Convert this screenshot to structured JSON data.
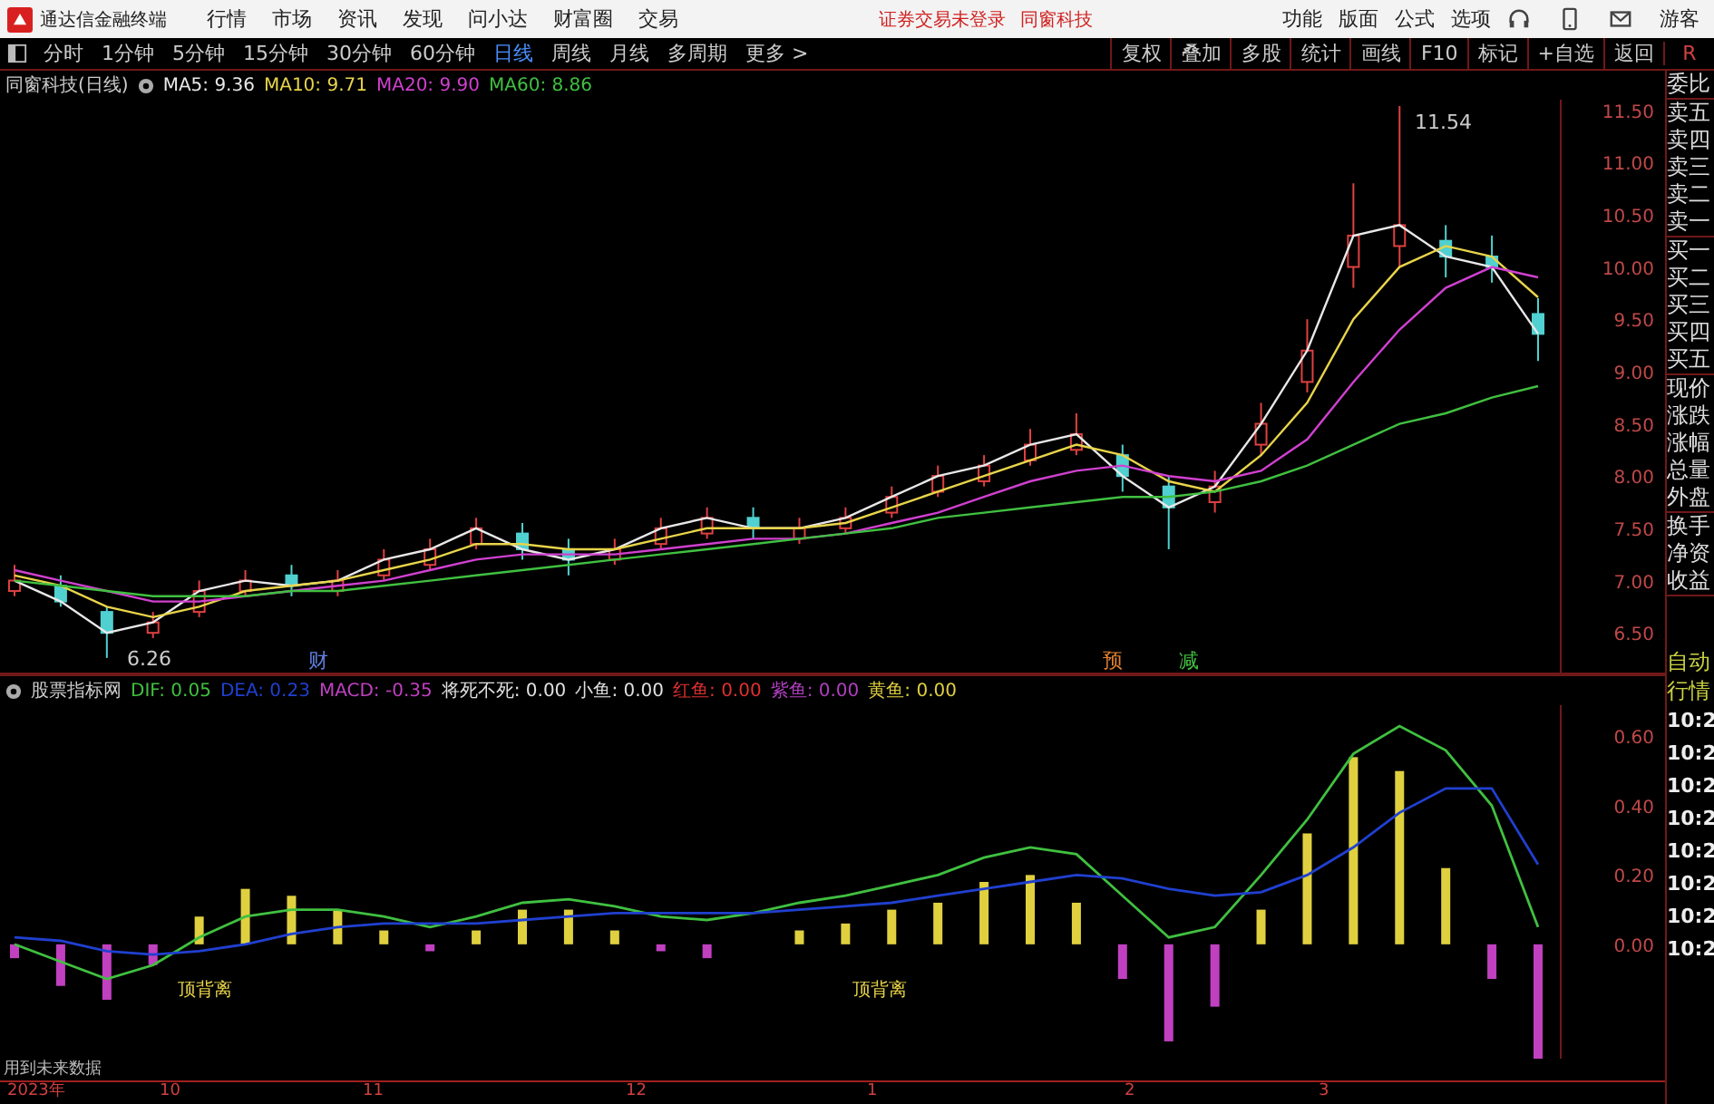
{
  "titlebar": {
    "app_name": "通达信金融终端",
    "menu": [
      "行情",
      "市场",
      "资讯",
      "发现",
      "问小达",
      "财富圈",
      "交易"
    ],
    "notices": [
      "证券交易未登录",
      "同窗科技"
    ],
    "tools": [
      "功能",
      "版面",
      "公式",
      "选项"
    ],
    "user": "游客"
  },
  "period_tabs": [
    {
      "label": "分时",
      "selected": false
    },
    {
      "label": "1分钟",
      "selected": false
    },
    {
      "label": "5分钟",
      "selected": false
    },
    {
      "label": "15分钟",
      "selected": false
    },
    {
      "label": "30分钟",
      "selected": false
    },
    {
      "label": "60分钟",
      "selected": false
    },
    {
      "label": "日线",
      "selected": true
    },
    {
      "label": "周线",
      "selected": false
    },
    {
      "label": "月线",
      "selected": false
    },
    {
      "label": "多周期",
      "selected": false
    },
    {
      "label": "更多 >",
      "selected": false
    }
  ],
  "chart_buttons": [
    "复权",
    "叠加",
    "多股",
    "统计",
    "画线",
    "F10",
    "标记",
    "+自选",
    "返回"
  ],
  "price_pane": {
    "title": "同窗科技(日线)",
    "legend": [
      {
        "label": "MA5: 9.36",
        "color": "#e8e8e8"
      },
      {
        "label": "MA10: 9.71",
        "color": "#e8d44a"
      },
      {
        "label": "MA20: 9.90",
        "color": "#d040d0"
      },
      {
        "label": "MA60: 8.86",
        "color": "#40c040"
      }
    ],
    "annotations": [
      "11.54",
      "6.26",
      "财",
      "预",
      "减"
    ],
    "candles": {
      "chart_data": {
        "type": "candlestick",
        "ylim": [
          6.12,
          11.6
        ],
        "yticks": [
          {
            "value": 6.5,
            "label": "6.50"
          },
          {
            "value": 7,
            "label": "7.00"
          },
          {
            "value": 7.5,
            "label": "7.50"
          },
          {
            "value": 8,
            "label": "8.00"
          },
          {
            "value": 8.5,
            "label": "8.50"
          },
          {
            "value": 9,
            "label": "9.00"
          },
          {
            "value": 9.5,
            "label": "9.50"
          },
          {
            "value": 10,
            "label": "10.00"
          },
          {
            "value": 10.5,
            "label": "10.50"
          },
          {
            "value": 11,
            "label": "11.00"
          },
          {
            "value": 11.5,
            "label": "11.50"
          }
        ],
        "ohlc": [
          [
            6.9,
            7.15,
            6.85,
            7.0
          ],
          [
            6.95,
            7.05,
            6.75,
            6.8
          ],
          [
            6.7,
            6.75,
            6.26,
            6.5
          ],
          [
            6.5,
            6.7,
            6.45,
            6.6
          ],
          [
            6.7,
            7.0,
            6.65,
            6.9
          ],
          [
            6.9,
            7.1,
            6.85,
            7.0
          ],
          [
            7.05,
            7.15,
            6.85,
            6.95
          ],
          [
            6.9,
            7.1,
            6.85,
            7.0
          ],
          [
            7.05,
            7.3,
            7.0,
            7.2
          ],
          [
            7.15,
            7.4,
            7.1,
            7.3
          ],
          [
            7.35,
            7.6,
            7.3,
            7.5
          ],
          [
            7.45,
            7.55,
            7.2,
            7.3
          ],
          [
            7.3,
            7.4,
            7.05,
            7.2
          ],
          [
            7.2,
            7.4,
            7.15,
            7.3
          ],
          [
            7.35,
            7.6,
            7.3,
            7.5
          ],
          [
            7.45,
            7.7,
            7.4,
            7.6
          ],
          [
            7.6,
            7.7,
            7.4,
            7.5
          ],
          [
            7.4,
            7.6,
            7.35,
            7.5
          ],
          [
            7.5,
            7.7,
            7.45,
            7.6
          ],
          [
            7.65,
            7.9,
            7.6,
            7.8
          ],
          [
            7.85,
            8.1,
            7.8,
            8.0
          ],
          [
            7.95,
            8.2,
            7.9,
            8.1
          ],
          [
            8.15,
            8.45,
            8.1,
            8.3
          ],
          [
            8.25,
            8.6,
            8.2,
            8.4
          ],
          [
            8.2,
            8.3,
            7.85,
            8.0
          ],
          [
            7.9,
            8.0,
            7.3,
            7.7
          ],
          [
            7.75,
            8.05,
            7.65,
            7.9
          ],
          [
            8.3,
            8.7,
            8.2,
            8.5
          ],
          [
            8.9,
            9.5,
            8.8,
            9.2
          ],
          [
            10.0,
            10.8,
            9.8,
            10.3
          ],
          [
            10.2,
            11.54,
            10.0,
            10.4
          ],
          [
            10.25,
            10.4,
            9.9,
            10.1
          ],
          [
            10.1,
            10.3,
            9.85,
            10.0
          ],
          [
            9.55,
            9.7,
            9.1,
            9.36
          ]
        ]
      }
    },
    "moving_averages": {
      "chart_data": {
        "type": "line",
        "ylim": [
          6.12,
          11.6
        ],
        "series": [
          {
            "color": "#e8e8e8",
            "values": [
              7.0,
              6.8,
              6.5,
              6.6,
              6.9,
              7.0,
              6.95,
              7.0,
              7.2,
              7.3,
              7.5,
              7.3,
              7.2,
              7.3,
              7.5,
              7.6,
              7.5,
              7.5,
              7.6,
              7.8,
              8.0,
              8.1,
              8.3,
              8.4,
              8.0,
              7.7,
              7.9,
              8.5,
              9.2,
              10.3,
              10.4,
              10.1,
              10.0,
              9.36
            ]
          },
          {
            "color": "#e8d44a",
            "values": [
              7.05,
              6.95,
              6.75,
              6.65,
              6.75,
              6.9,
              6.95,
              7.0,
              7.1,
              7.2,
              7.35,
              7.35,
              7.3,
              7.3,
              7.4,
              7.5,
              7.5,
              7.5,
              7.55,
              7.7,
              7.85,
              8.0,
              8.15,
              8.3,
              8.2,
              7.95,
              7.85,
              8.2,
              8.7,
              9.5,
              10.0,
              10.2,
              10.1,
              9.71
            ]
          },
          {
            "color": "#d040d0",
            "values": [
              7.1,
              7.0,
              6.9,
              6.8,
              6.8,
              6.85,
              6.9,
              6.95,
              7.0,
              7.1,
              7.2,
              7.25,
              7.25,
              7.25,
              7.3,
              7.35,
              7.4,
              7.4,
              7.45,
              7.55,
              7.65,
              7.8,
              7.95,
              8.05,
              8.1,
              8.0,
              7.95,
              8.05,
              8.35,
              8.9,
              9.4,
              9.8,
              10.0,
              9.9
            ]
          },
          {
            "color": "#40c040",
            "values": [
              7.0,
              6.95,
              6.9,
              6.85,
              6.85,
              6.85,
              6.9,
              6.9,
              6.95,
              7.0,
              7.05,
              7.1,
              7.15,
              7.2,
              7.25,
              7.3,
              7.35,
              7.4,
              7.45,
              7.5,
              7.6,
              7.65,
              7.7,
              7.75,
              7.8,
              7.8,
              7.85,
              7.95,
              8.1,
              8.3,
              8.5,
              8.6,
              8.75,
              8.86
            ]
          }
        ]
      }
    }
  },
  "macd_pane": {
    "title": "股票指标网",
    "legend": [
      {
        "label": "DIF: 0.05",
        "color": "#40c040"
      },
      {
        "label": "DEA: 0.23",
        "color": "#2040d0"
      },
      {
        "label": "MACD: -0.35",
        "color": "#c040c0"
      },
      {
        "label": "将死不死: 0.00",
        "color": "#e0e0e0"
      },
      {
        "label": "小鱼: 0.00",
        "color": "#e0e0e0"
      },
      {
        "label": "红鱼: 0.00",
        "color": "#e03030"
      },
      {
        "label": "紫鱼: 0.00",
        "color": "#b040c0"
      },
      {
        "label": "黄鱼: 0.00",
        "color": "#e0d040"
      }
    ],
    "annotations": [
      "顶背离",
      "顶背离"
    ],
    "histogram": {
      "chart_data": {
        "type": "bar",
        "ylim": [
          -0.33,
          0.69
        ],
        "series": [
          {
            "color": "#e0d040",
            "values": [
              null,
              null,
              null,
              null,
              0.08,
              0.16,
              0.14,
              0.1,
              0.04,
              null,
              0.04,
              0.1,
              0.1,
              0.04,
              null,
              null,
              null,
              0.04,
              0.06,
              0.1,
              0.12,
              0.18,
              0.2,
              0.12,
              null,
              null,
              null,
              0.1,
              0.32,
              0.54,
              0.5,
              0.22,
              null,
              null
            ]
          },
          {
            "color": "#c040c0",
            "values": [
              -0.04,
              -0.12,
              -0.16,
              -0.06,
              null,
              null,
              null,
              null,
              null,
              -0.02,
              null,
              null,
              null,
              null,
              -0.02,
              -0.04,
              null,
              null,
              null,
              null,
              null,
              null,
              null,
              null,
              -0.1,
              -0.28,
              -0.18,
              null,
              null,
              null,
              null,
              null,
              -0.1,
              -0.33
            ]
          }
        ]
      }
    },
    "lines": {
      "chart_data": {
        "type": "line",
        "ylim": [
          -0.33,
          0.69
        ],
        "yticks": [
          {
            "value": 0,
            "label": "0.00"
          },
          {
            "value": 0.2,
            "label": "0.20"
          },
          {
            "value": 0.4,
            "label": "0.40"
          },
          {
            "value": 0.6,
            "label": "0.60"
          }
        ],
        "series": [
          {
            "color": "#40c040",
            "values": [
              0.0,
              -0.05,
              -0.1,
              -0.06,
              0.02,
              0.08,
              0.1,
              0.1,
              0.08,
              0.05,
              0.08,
              0.12,
              0.13,
              0.11,
              0.08,
              0.07,
              0.09,
              0.12,
              0.14,
              0.17,
              0.2,
              0.25,
              0.28,
              0.26,
              0.14,
              0.02,
              0.05,
              0.2,
              0.36,
              0.55,
              0.63,
              0.56,
              0.4,
              0.05
            ]
          },
          {
            "color": "#2040d0",
            "values": [
              0.02,
              0.01,
              -0.02,
              -0.03,
              -0.02,
              0.0,
              0.03,
              0.05,
              0.06,
              0.06,
              0.06,
              0.07,
              0.08,
              0.09,
              0.09,
              0.09,
              0.09,
              0.1,
              0.11,
              0.12,
              0.14,
              0.16,
              0.18,
              0.2,
              0.19,
              0.16,
              0.14,
              0.15,
              0.2,
              0.28,
              0.38,
              0.45,
              0.45,
              0.23
            ]
          }
        ]
      }
    }
  },
  "footer_note": "用到未来数据",
  "date_axis": [
    "2023年",
    "10",
    "11",
    "12",
    "1",
    "2",
    "3"
  ],
  "side_panel": {
    "header": "R",
    "quote_groups": [
      [
        "委比"
      ],
      [
        "卖五",
        "卖四",
        "卖三",
        "卖二",
        "卖一"
      ],
      [
        "买一",
        "买二",
        "买三",
        "买四",
        "买五"
      ],
      [
        "现价",
        "涨跌",
        "涨幅",
        "总量",
        "外盘"
      ],
      [
        "换手",
        "净资",
        "收益"
      ]
    ],
    "mode_labels": [
      "自动",
      "行情"
    ],
    "times": [
      "10:2",
      "10:2",
      "10:2",
      "10:2",
      "10:2",
      "10:2",
      "10:2",
      "10:2"
    ]
  }
}
